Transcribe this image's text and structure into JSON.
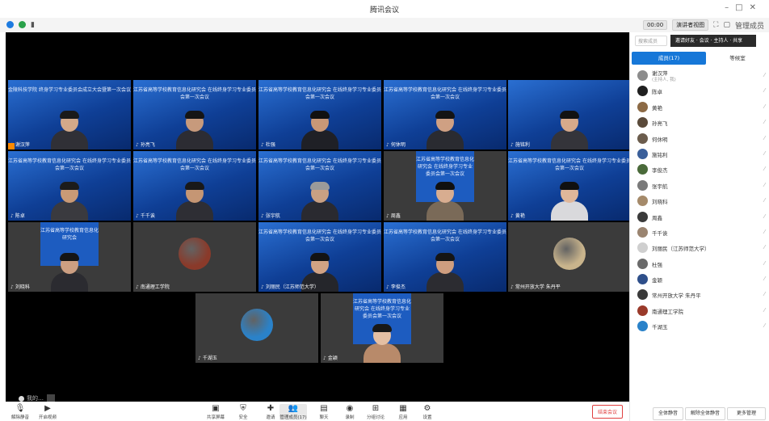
{
  "window": {
    "title": "腾讯会议"
  },
  "toolbar": {
    "net_label": "00:00",
    "view_label": "演讲者视图",
    "manage_label": "管理成员"
  },
  "grid_banner": "江苏省高等学校教育信息化研究会在线终身学习专业委员会第一次会议",
  "tiles": [
    {
      "name": "谢汉萍",
      "style": "blue",
      "kind": "person",
      "banner": "金陵科技学院 终身学习专业委员会成立大会暨第一次会议",
      "hair": "#1a1a1a",
      "skin": "#d2a98a",
      "shirt": "#303036",
      "host": true
    },
    {
      "name": "孙亮飞",
      "style": "blue",
      "kind": "person",
      "banner": "江苏省高等学校教育信息化研究会 在线终身学习专业委员会第一次会议",
      "hair": "#151515",
      "skin": "#c79a7c",
      "shirt": "#2c2c33"
    },
    {
      "name": "杜强",
      "style": "blue",
      "kind": "person",
      "banner": "江苏省高等学校教育信息化研究会 在线终身学习专业委员会第一次会议",
      "hair": "#111111",
      "skin": "#c89877",
      "shirt": "#1f2026"
    },
    {
      "name": "何休明",
      "style": "blue",
      "kind": "person",
      "banner": "江苏省高等学校教育信息化研究会 在线终身学习专业委员会第一次会议",
      "hair": "#141414",
      "skin": "#cfa083",
      "shirt": "#2a2b31"
    },
    {
      "name": "施铭利",
      "style": "blue",
      "kind": "person",
      "banner": "",
      "hair": "#121212",
      "skin": "#d6a98b",
      "shirt": "#34343a"
    },
    {
      "name": "陈卓",
      "style": "blue",
      "kind": "person",
      "banner": "江苏省高等学校教育信息化研究会 在线终身学习专业委员会第一次会议",
      "hair": "#1c1c1c",
      "skin": "#c99a76",
      "shirt": "#3a3a3f"
    },
    {
      "name": "千千诶",
      "style": "blue",
      "kind": "person",
      "banner": "江苏省高等学校教育信息化研究会 在线终身学习专业委员会第一次会议",
      "hair": "#191919",
      "skin": "#c59674",
      "shirt": "#2e2e34"
    },
    {
      "name": "张宇航",
      "style": "blue",
      "kind": "person",
      "banner": "江苏省高等学校教育信息化研究会 在线终身学习专业委员会第一次会议",
      "hair": "#9a9a9a",
      "skin": "#c9a083",
      "shirt": "#2a2a30"
    },
    {
      "name": "周鑫",
      "style": "dark",
      "kind": "person",
      "banner": "江苏省高等学校教育信息化研究会 在线终身学习专业委员会第一次会议",
      "hair": "#101010",
      "skin": "#d8ad90",
      "shirt": "#7a6a58"
    },
    {
      "name": "黄艳",
      "style": "blue",
      "kind": "person",
      "banner": "江苏省高等学校教育信息化研究会 在线终身学习专业委员会第一次会议",
      "hair": "#101010",
      "skin": "#e0b79a",
      "shirt": "#d9d9dc"
    },
    {
      "name": "刘晓科",
      "style": "dark",
      "kind": "person",
      "banner": "江苏省高等学校教育信息化研究会",
      "hair": "#151515",
      "skin": "#cc9f82",
      "shirt": "#2b2b30"
    },
    {
      "name": "南通理工学院",
      "style": "dark",
      "kind": "avatar",
      "banner": "",
      "avatar": "#8a3a2a"
    },
    {
      "name": "刘丽民（江苏师范大学）",
      "style": "blue",
      "kind": "person",
      "banner": "江苏省高等学校教育信息化研究会 在线终身学习专业委员会第一次会议",
      "hair": "#131313",
      "skin": "#d1a384",
      "shirt": "#25262b"
    },
    {
      "name": "李俊杰",
      "style": "blue",
      "kind": "person",
      "banner": "江苏省高等学校教育信息化研究会 在线终身学习专业委员会第一次会议",
      "hair": "#151515",
      "skin": "#cf9e7f",
      "shirt": "#2c2c31"
    },
    {
      "name": "常州开放大学 朱丹平",
      "style": "dark",
      "kind": "avatar",
      "banner": "",
      "avatar": "#c9b48c"
    },
    {
      "name": "千湖玉",
      "style": "dark",
      "kind": "avatar",
      "banner": "",
      "avatar": "#2a82c9"
    },
    {
      "name": "金颖",
      "style": "dark",
      "kind": "person",
      "banner": "江苏省高等学校教育信息化研究会 在线终身学习专业委员会第一次会议",
      "hair": "#181818",
      "skin": "#e4bfa3",
      "shirt": "#b88a6a"
    }
  ],
  "self_view": {
    "label": "我的…",
    "mic_label": "静音"
  },
  "bottombar": {
    "buttons": [
      {
        "label": "解除静音",
        "icon": "mic-icon"
      },
      {
        "label": "开启视频",
        "icon": "camera-icon"
      },
      {
        "label": "共享屏幕",
        "icon": "share-icon"
      },
      {
        "label": "安全",
        "icon": "shield-icon"
      },
      {
        "label": "邀请",
        "icon": "invite-icon"
      },
      {
        "label": "管理成员(17)",
        "icon": "members-icon"
      },
      {
        "label": "聊天",
        "icon": "chat-icon"
      },
      {
        "label": "录制",
        "icon": "record-icon"
      },
      {
        "label": "分组讨论",
        "icon": "breakout-icon"
      },
      {
        "label": "应用",
        "icon": "apps-icon"
      },
      {
        "label": "设置",
        "icon": "settings-icon"
      }
    ],
    "leave_label": "结束会议"
  },
  "panel": {
    "search_placeholder": "搜索成员",
    "header_text": "邀请好友 · 会议 · 主持人 · 共享",
    "tab_members": "成员(17)",
    "tab_waiting": "等候室",
    "members": [
      {
        "name": "谢汉萍",
        "sub": "(主持人, 我)",
        "avatar": "#8c8c8c"
      },
      {
        "name": "陈卓",
        "avatar": "#1f1f1f"
      },
      {
        "name": "黄艳",
        "avatar": "#8c6a45"
      },
      {
        "name": "孙亮飞",
        "avatar": "#5a4a3a"
      },
      {
        "name": "何休明",
        "avatar": "#6b5c4d"
      },
      {
        "name": "施铭利",
        "avatar": "#3a5f9a"
      },
      {
        "name": "李俊杰",
        "avatar": "#4a6a3a"
      },
      {
        "name": "张宇航",
        "avatar": "#7a7a7a"
      },
      {
        "name": "刘晓科",
        "avatar": "#a58a6a"
      },
      {
        "name": "周鑫",
        "avatar": "#3a3a3a"
      },
      {
        "name": "千千诶",
        "avatar": "#9a8470"
      },
      {
        "name": "刘丽民（江苏师范大学）",
        "avatar": "#cfcfcf"
      },
      {
        "name": "杜强",
        "avatar": "#6a6a6a"
      },
      {
        "name": "金颖",
        "avatar": "#2e4f8a"
      },
      {
        "name": "常州开放大学 朱丹平",
        "avatar": "#3a3a3a"
      },
      {
        "name": "南通理工学院",
        "avatar": "#9a3a2a"
      },
      {
        "name": "千湖玉",
        "avatar": "#2a82c9"
      }
    ],
    "btn_mute_all": "全体静音",
    "btn_unmute_all": "解除全体静音",
    "btn_more": "更多管理"
  },
  "colors": {
    "accent": "#1677d8",
    "leave": "#e04040",
    "tile_blue": "#1a56b8"
  }
}
